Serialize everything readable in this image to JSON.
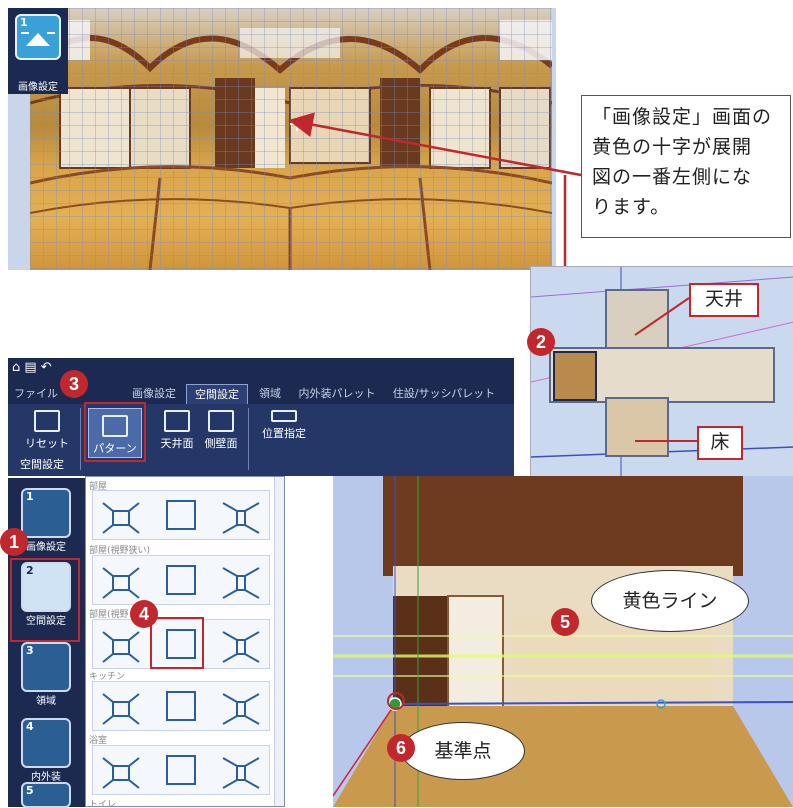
{
  "panorama": {
    "icon_number": "1",
    "icon_label": "画像設定"
  },
  "callout": {
    "lines": [
      "「画像設定」画面の",
      "黄色の十字が展開",
      "図の一番左側にな",
      "ります。"
    ]
  },
  "layout_view": {
    "ceiling_label": "天井",
    "floor_label": "床"
  },
  "badges": [
    "1",
    "2",
    "3",
    "4",
    "5",
    "6"
  ],
  "ribbon": {
    "tabs": [
      "ファイル",
      "画像設定",
      "空間設定",
      "領域",
      "内外装パレット",
      "住設/サッシパレット"
    ],
    "active_tab": "空間設定",
    "buttons": {
      "reset": "リセット",
      "pattern": "パターン",
      "ceiling_face": "天井面",
      "side_wall": "側壁面",
      "position": "位置指定"
    },
    "groups": [
      "空間設定"
    ]
  },
  "vertical_toolbar": [
    {
      "number": "1",
      "label": "画像設定"
    },
    {
      "number": "2",
      "label": "空間設定"
    },
    {
      "number": "3",
      "label": "領域"
    },
    {
      "number": "4",
      "label": "内外装"
    },
    {
      "number": "5",
      "label": ""
    }
  ],
  "pattern_dropdown": {
    "categories": [
      "部屋",
      "部屋(視野狭い)",
      "部屋(視野",
      "キッチン",
      "浴室",
      "トイレ"
    ]
  },
  "room_view": {
    "yellow_line_label": "黄色ライン",
    "base_point_label": "基準点"
  },
  "colors": {
    "accent_red": "#c0282e",
    "toolbar_navy": "#1c2a52",
    "icon_blue": "#3aa0d8"
  }
}
